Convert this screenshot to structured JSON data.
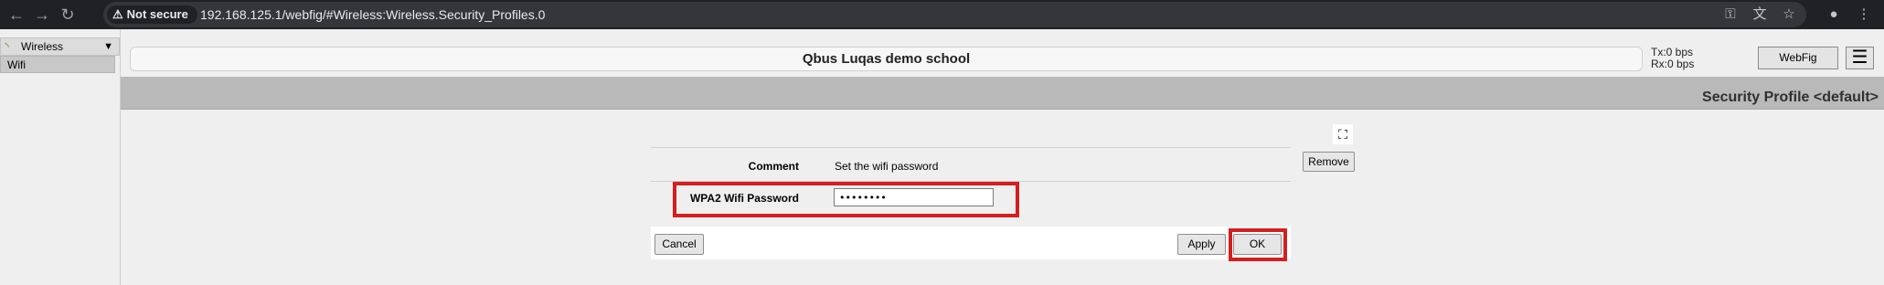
{
  "browser": {
    "security_label": "Not secure",
    "url": "192.168.125.1/webfig/#Wireless:Wireless.Security_Profiles.0"
  },
  "sidebar": {
    "menu_label": "Wireless",
    "items": [
      {
        "label": "Wifi"
      }
    ]
  },
  "header": {
    "title": "Qbus Luqas demo school",
    "tx": "Tx:0 bps",
    "rx": "Rx:0 bps",
    "webfig_label": "WebFig"
  },
  "page": {
    "title": "Security Profile <default>"
  },
  "form": {
    "comment_label": "Comment",
    "comment_value": "Set the wifi password",
    "password_label": "WPA2 Wifi Password",
    "password_value": "••••••••",
    "remove_label": "Remove",
    "cancel_label": "Cancel",
    "apply_label": "Apply",
    "ok_label": "OK"
  },
  "colors": {
    "highlight": "#d51e1e"
  }
}
